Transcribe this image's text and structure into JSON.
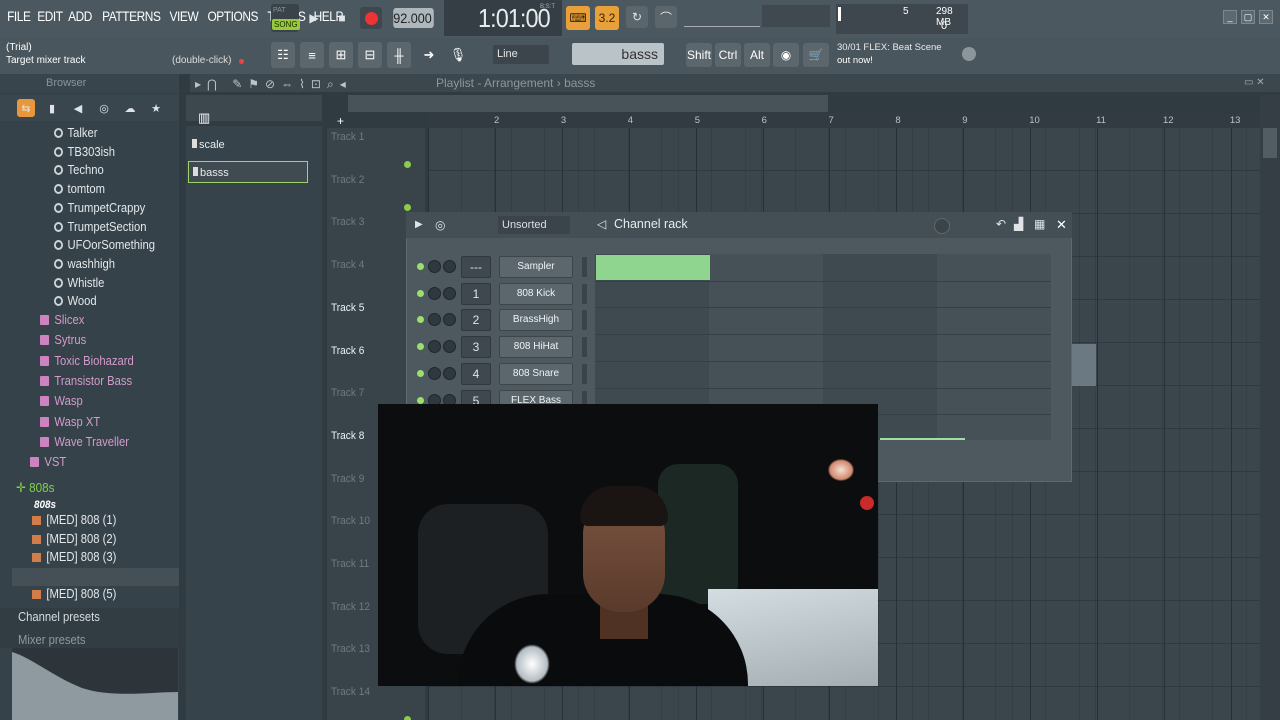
{
  "menu": [
    "FILE",
    "EDIT",
    "ADD",
    "PATTERNS",
    "VIEW",
    "OPTIONS",
    "TOOLS",
    "HELP"
  ],
  "transport": {
    "pat_label": "PAT",
    "song_label": "SONG",
    "play_icon": "play-icon",
    "stop_icon": "stop-icon",
    "record_icon": "record-icon"
  },
  "tempo": {
    "value": "92.000"
  },
  "time": {
    "display": "1:01:00",
    "unit": "B:S:T"
  },
  "toolbar_orange": {
    "snap_label": "3.2"
  },
  "cpu": {
    "mem": "298 MB",
    "cpu_value": "5",
    "polyphony": "0"
  },
  "hint": {
    "line1": "(Trial)",
    "line2": "Target mixer track",
    "action": "(double-click)"
  },
  "snap": {
    "value": "Line"
  },
  "pattern_selector": {
    "value": "basss"
  },
  "modifiers": [
    "Shift",
    "Ctrl",
    "Alt"
  ],
  "news": {
    "date": "30/01",
    "headline": "FLEX: Beat Scene",
    "sub": "out now!"
  },
  "browser": {
    "title": "Browser",
    "items": [
      {
        "kind": "gen",
        "label": "Talker"
      },
      {
        "kind": "gen",
        "label": "TB303ish"
      },
      {
        "kind": "gen",
        "label": "Techno"
      },
      {
        "kind": "gen",
        "label": "tomtom"
      },
      {
        "kind": "gen",
        "label": "TrumpetCrappy"
      },
      {
        "kind": "gen",
        "label": "TrumpetSection"
      },
      {
        "kind": "gen",
        "label": "UFOorSomething"
      },
      {
        "kind": "gen",
        "label": "washhigh"
      },
      {
        "kind": "gen",
        "label": "Whistle"
      },
      {
        "kind": "gen",
        "label": "Wood"
      },
      {
        "kind": "plugin",
        "label": "Slicex"
      },
      {
        "kind": "plugin",
        "label": "Sytrus"
      },
      {
        "kind": "plugin",
        "label": "Toxic Biohazard"
      },
      {
        "kind": "plugin",
        "label": "Transistor Bass"
      },
      {
        "kind": "plugin",
        "label": "Wasp"
      },
      {
        "kind": "plugin",
        "label": "Wasp XT"
      },
      {
        "kind": "plugin",
        "label": "Wave Traveller"
      },
      {
        "kind": "plugin",
        "label": "VST"
      }
    ],
    "folder": "808s",
    "subfolder": "808s",
    "samples": [
      "[MED] 808 (1)",
      "[MED] 808 (2)",
      "[MED] 808 (3)",
      "[MED] 808 (4)",
      "[MED] 808 (5)"
    ],
    "footer1": "Channel presets",
    "footer2": "Mixer presets"
  },
  "patterns": [
    {
      "label": "scale",
      "selected": false
    },
    {
      "label": "basss",
      "selected": true
    }
  ],
  "playlist": {
    "title": "Playlist - Arrangement",
    "pattern": "basss",
    "ruler": [
      "2",
      "3",
      "4",
      "5",
      "6",
      "7",
      "8",
      "9",
      "10",
      "11",
      "12",
      "13"
    ],
    "tracks": [
      {
        "label": "Track 1",
        "bright": false
      },
      {
        "label": "Track 2",
        "bright": false
      },
      {
        "label": "Track 3",
        "bright": false
      },
      {
        "label": "Track 4",
        "bright": false
      },
      {
        "label": "Track 5",
        "bright": true
      },
      {
        "label": "Track 6",
        "bright": true
      },
      {
        "label": "Track 7",
        "bright": false
      },
      {
        "label": "Track 8",
        "bright": true
      },
      {
        "label": "Track 9",
        "bright": false
      },
      {
        "label": "Track 10",
        "bright": false
      },
      {
        "label": "Track 11",
        "bright": false
      },
      {
        "label": "Track 12",
        "bright": false
      },
      {
        "label": "Track 13",
        "bright": false
      },
      {
        "label": "Track 14",
        "bright": false
      }
    ]
  },
  "channel_rack": {
    "title": "Channel rack",
    "filter": "Unsorted",
    "channels": [
      {
        "num": "---",
        "name": "Sampler"
      },
      {
        "num": "1",
        "name": "808 Kick"
      },
      {
        "num": "2",
        "name": "BrassHigh"
      },
      {
        "num": "3",
        "name": "808 HiHat"
      },
      {
        "num": "4",
        "name": "808 Snare"
      },
      {
        "num": "5",
        "name": "FLEX Bass"
      }
    ]
  }
}
